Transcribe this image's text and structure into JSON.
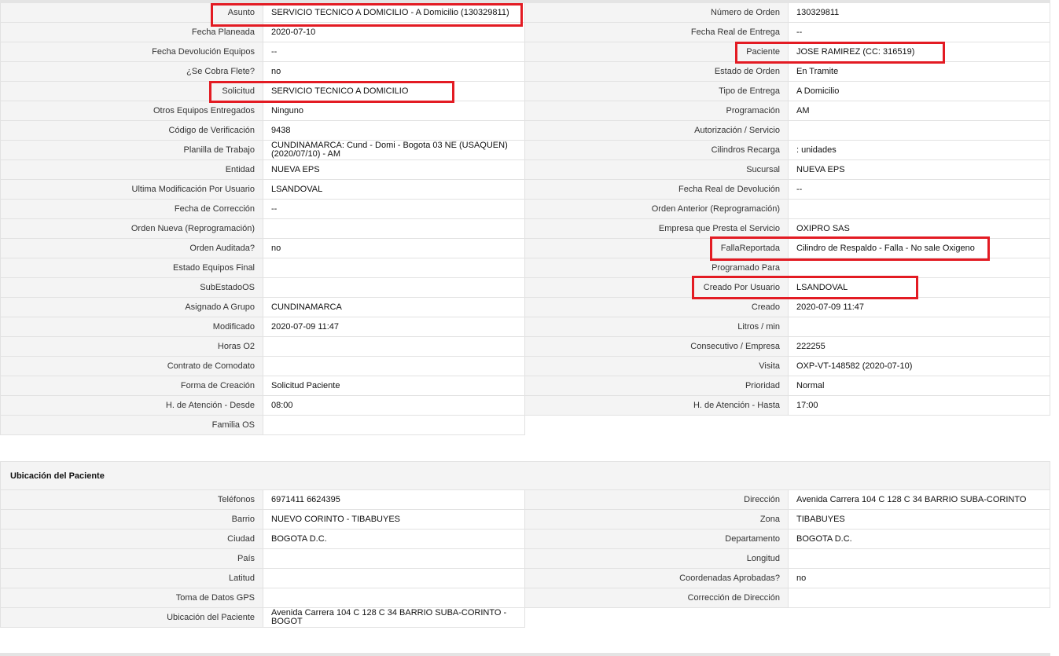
{
  "order_fields": [
    {
      "left_label": "Asunto",
      "left_value": "SERVICIO TECNICO A DOMICILIO - A Domicilio (130329811)",
      "right_label": "Número de Orden",
      "right_value": "130329811"
    },
    {
      "left_label": "Fecha Planeada",
      "left_value": "2020-07-10",
      "right_label": "Fecha Real de Entrega",
      "right_value": "--"
    },
    {
      "left_label": "Fecha Devolución Equipos",
      "left_value": "--",
      "right_label": "Paciente",
      "right_value": "JOSE RAMIREZ (CC: 316519)"
    },
    {
      "left_label": "¿Se Cobra Flete?",
      "left_value": "no",
      "right_label": "Estado de Orden",
      "right_value": "En Tramite"
    },
    {
      "left_label": "Solicitud",
      "left_value": "SERVICIO TECNICO A DOMICILIO",
      "right_label": "Tipo de Entrega",
      "right_value": "A Domicilio"
    },
    {
      "left_label": "Otros Equipos Entregados",
      "left_value": "Ninguno",
      "right_label": "Programación",
      "right_value": "AM"
    },
    {
      "left_label": "Código de Verificación",
      "left_value": "9438",
      "right_label": "Autorización / Servicio",
      "right_value": ""
    },
    {
      "left_label": "Planilla de Trabajo",
      "left_value": "CUNDINAMARCA: Cund - Domi - Bogota 03 NE (USAQUEN) (2020/07/10) - AM",
      "right_label": "Cilindros Recarga",
      "right_value": ": unidades"
    },
    {
      "left_label": "Entidad",
      "left_value": "NUEVA EPS",
      "right_label": "Sucursal",
      "right_value": "NUEVA EPS"
    },
    {
      "left_label": "Ultima Modificación Por Usuario",
      "left_value": "LSANDOVAL",
      "right_label": "Fecha Real de Devolución",
      "right_value": "--"
    },
    {
      "left_label": "Fecha de Corrección",
      "left_value": "--",
      "right_label": "Orden Anterior (Reprogramación)",
      "right_value": ""
    },
    {
      "left_label": "Orden Nueva (Reprogramación)",
      "left_value": "",
      "right_label": "Empresa que Presta el Servicio",
      "right_value": "OXIPRO SAS"
    },
    {
      "left_label": "Orden Auditada?",
      "left_value": "no",
      "right_label": "FallaReportada",
      "right_value": "Cilindro de Respaldo - Falla - No sale Oxigeno"
    },
    {
      "left_label": "Estado Equipos Final",
      "left_value": "",
      "right_label": "Programado Para",
      "right_value": ""
    },
    {
      "left_label": "SubEstadoOS",
      "left_value": "",
      "right_label": "Creado Por Usuario",
      "right_value": "LSANDOVAL"
    },
    {
      "left_label": "Asignado A Grupo",
      "left_value": "CUNDINAMARCA",
      "right_label": "Creado",
      "right_value": "2020-07-09 11:47"
    },
    {
      "left_label": "Modificado",
      "left_value": "2020-07-09 11:47",
      "right_label": "Litros / min",
      "right_value": ""
    },
    {
      "left_label": "Horas O2",
      "left_value": "",
      "right_label": "Consecutivo / Empresa",
      "right_value": "222255"
    },
    {
      "left_label": "Contrato de Comodato",
      "left_value": "",
      "right_label": "Visita",
      "right_value": "OXP-VT-148582 (2020-07-10)"
    },
    {
      "left_label": "Forma de Creación",
      "left_value": "Solicitud Paciente",
      "right_label": "Prioridad",
      "right_value": "Normal"
    },
    {
      "left_label": "H. de Atención - Desde",
      "left_value": "08:00",
      "right_label": "H. de Atención - Hasta",
      "right_value": "17:00"
    },
    {
      "left_label": "Familia OS",
      "left_value": ""
    }
  ],
  "location_section": {
    "title": "Ubicación del Paciente",
    "fields": [
      {
        "left_label": "Teléfonos",
        "left_value": "6971411 6624395",
        "right_label": "Dirección",
        "right_value": "Avenida Carrera 104 C 128 C 34 BARRIO SUBA-CORINTO"
      },
      {
        "left_label": "Barrio",
        "left_value": "NUEVO CORINTO - TIBABUYES",
        "right_label": "Zona",
        "right_value": "TIBABUYES"
      },
      {
        "left_label": "Ciudad",
        "left_value": "BOGOTA D.C.",
        "right_label": "Departamento",
        "right_value": "BOGOTA D.C."
      },
      {
        "left_label": "País",
        "left_value": "",
        "right_label": "Longitud",
        "right_value": ""
      },
      {
        "left_label": "Latitud",
        "left_value": "",
        "right_label": "Coordenadas Aprobadas?",
        "right_value": "no"
      },
      {
        "left_label": "Toma de Datos GPS",
        "left_value": "",
        "right_label": "Corrección de Dirección",
        "right_value": ""
      },
      {
        "left_label": "Ubicación del Paciente",
        "left_value": "Avenida Carrera 104 C 128 C 34 BARRIO SUBA-CORINTO - BOGOT"
      }
    ]
  },
  "highlight_color": "#e31b23"
}
